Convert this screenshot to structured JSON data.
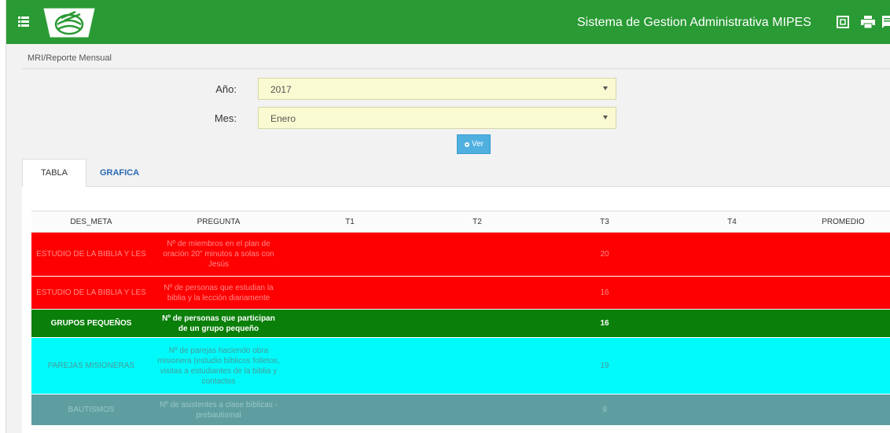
{
  "header": {
    "app_title": "Sistema de Gestion Administrativa MIPES",
    "icons": [
      "menu-icon",
      "logo-bible",
      "fullscreen-icon",
      "print-icon",
      "chat-icon"
    ],
    "color": "#2a9a34"
  },
  "breadcrumb": "MRI/Reporte Mensual",
  "filters": {
    "year_label": "Año:",
    "year_value": "2017",
    "month_label": "Mes:",
    "month_value": "Enero",
    "ver_label": "Ver"
  },
  "tabs": [
    {
      "label": "TABLA",
      "active": true
    },
    {
      "label": "GRAFICA",
      "active": false
    }
  ],
  "table": {
    "headers": [
      "DES_META",
      "PREGUNTA",
      "T1",
      "T2",
      "T3",
      "T4",
      "PROMEDIO"
    ],
    "rows": [
      {
        "des_meta": "ESTUDIO DE LA BIBLIA Y LES",
        "pregunta": "Nº de miembros en el plan de oración 20\" minutos a solas con Jesús",
        "t1": "",
        "t2": "",
        "t3": "20",
        "t4": "",
        "promedio": "",
        "color": "#ff0000"
      },
      {
        "des_meta": "ESTUDIO DE LA BIBLIA Y LES",
        "pregunta": "Nº de personas que estudian la biblia y la lección diariamente",
        "t1": "",
        "t2": "",
        "t3": "16",
        "t4": "",
        "promedio": "",
        "color": "#ff0000"
      },
      {
        "des_meta": "GRUPOS PEQUEÑOS",
        "pregunta": "Nº de personas que participan de un grupo pequeño",
        "t1": "",
        "t2": "",
        "t3": "16",
        "t4": "",
        "promedio": "",
        "color": "#0a7f0a"
      },
      {
        "des_meta": "PAREJAS MISIONERAS",
        "pregunta": "Nº de parejas haciendo obra misionera (estudio bíblicos folletos, visitas a estudiantes de la biblia y contactos",
        "t1": "",
        "t2": "",
        "t3": "19",
        "t4": "",
        "promedio": "",
        "color": "#00fafa"
      },
      {
        "des_meta": "BAUTISMOS",
        "pregunta": "Nº de asistentes a clase bíblicas - prebautismal",
        "t1": "",
        "t2": "",
        "t3": "9",
        "t4": "",
        "promedio": "",
        "color": "#5f9ea0"
      }
    ]
  }
}
